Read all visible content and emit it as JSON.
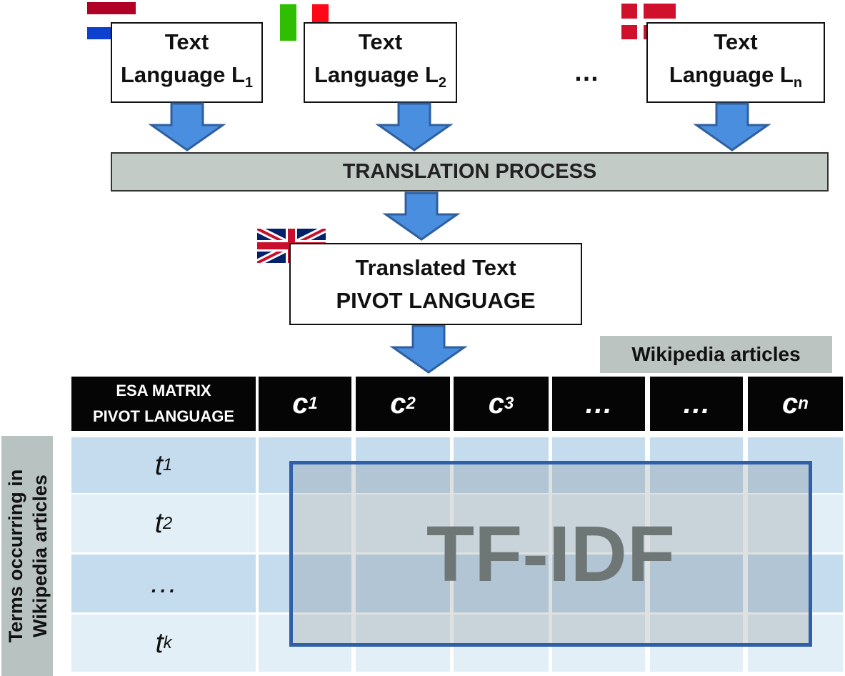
{
  "source_texts": [
    {
      "line1": "Text",
      "line2": "Language L",
      "sub": "1",
      "flag": "netherlands-flag"
    },
    {
      "line1": "Text",
      "line2": "Language L",
      "sub": "2",
      "flag": "italy-flag"
    },
    {
      "line1": "Text",
      "line2": "Language L",
      "sub": "n",
      "flag": "denmark-flag"
    }
  ],
  "ellipsis": "…",
  "translation_process": "TRANSLATION PROCESS",
  "translated": {
    "line1": "Translated Text",
    "line2": "PIVOT LANGUAGE",
    "flag": "uk-flag"
  },
  "wikipedia_label": "Wikipedia articles",
  "matrix": {
    "corner_line1": "ESA MATRIX",
    "corner_line2": "PIVOT LANGUAGE",
    "columns": [
      {
        "t": "c",
        "s": "1"
      },
      {
        "t": "c",
        "s": "2"
      },
      {
        "t": "c",
        "s": "3"
      },
      {
        "t": "…",
        "s": ""
      },
      {
        "t": "…",
        "s": ""
      },
      {
        "t": "c",
        "s": "n"
      }
    ],
    "rows": [
      {
        "t": "t",
        "s": "1"
      },
      {
        "t": "t",
        "s": "2"
      },
      {
        "t": "…",
        "s": ""
      },
      {
        "t": "t",
        "s": "k"
      }
    ],
    "row_axis_line1": "Terms occurring in",
    "row_axis_line2": "Wikipedia articles",
    "center_label": "TF-IDF"
  },
  "colors": {
    "arrow": "#4a8ee0",
    "arrow_border": "#2f5f9e",
    "row_dark": "#c5dcef",
    "row_light": "#e2eff6",
    "tfidf_border": "#2e5fa8"
  }
}
